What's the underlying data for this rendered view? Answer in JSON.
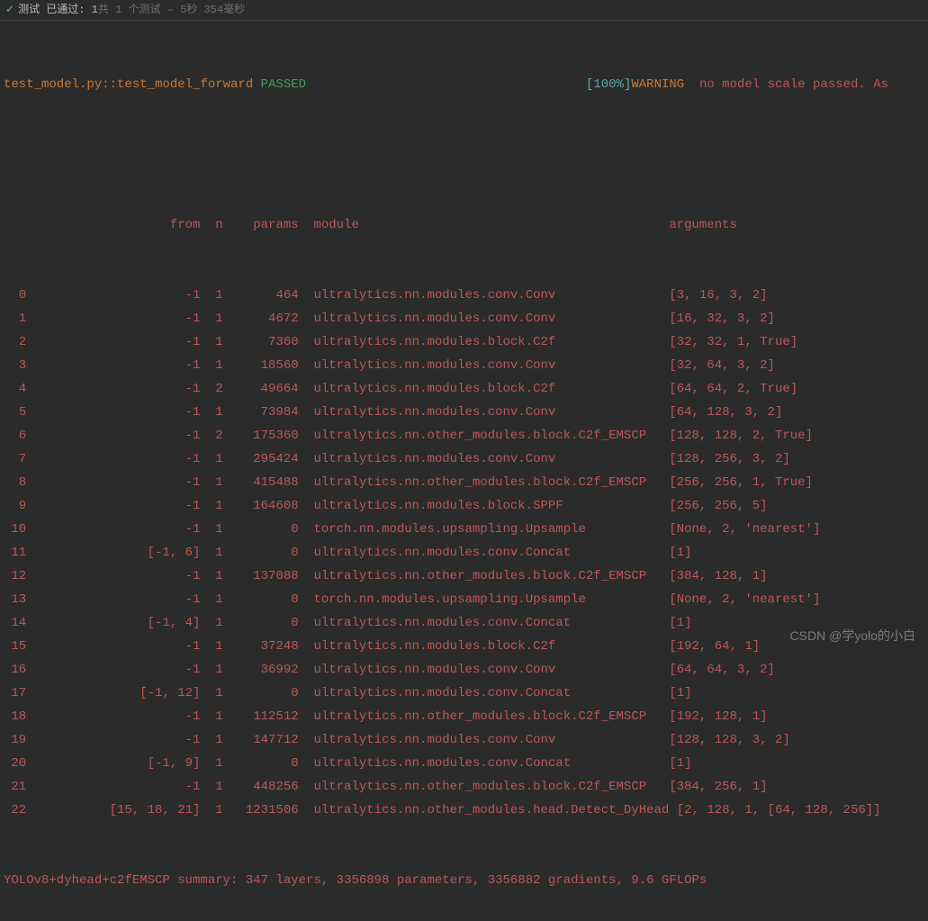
{
  "status": {
    "passed_label": "测试 已通过: 1",
    "detail": "共 1 个测试 – 5秒 354毫秒"
  },
  "header_line": {
    "test_path": "test_model.py::test_model_forward",
    "result": "PASSED",
    "progress": "[100%]",
    "warning_label": "WARNING",
    "warning_text": "  no model scale passed. As"
  },
  "columns": {
    "from": "from",
    "n": "n",
    "params": "params",
    "module": "module",
    "arguments": "arguments"
  },
  "rows": [
    {
      "idx": "0",
      "from": "-1",
      "n": "1",
      "params": "464",
      "module": "ultralytics.nn.modules.conv.Conv",
      "args": "[3, 16, 3, 2]"
    },
    {
      "idx": "1",
      "from": "-1",
      "n": "1",
      "params": "4672",
      "module": "ultralytics.nn.modules.conv.Conv",
      "args": "[16, 32, 3, 2]"
    },
    {
      "idx": "2",
      "from": "-1",
      "n": "1",
      "params": "7360",
      "module": "ultralytics.nn.modules.block.C2f",
      "args": "[32, 32, 1, True]"
    },
    {
      "idx": "3",
      "from": "-1",
      "n": "1",
      "params": "18560",
      "module": "ultralytics.nn.modules.conv.Conv",
      "args": "[32, 64, 3, 2]"
    },
    {
      "idx": "4",
      "from": "-1",
      "n": "2",
      "params": "49664",
      "module": "ultralytics.nn.modules.block.C2f",
      "args": "[64, 64, 2, True]"
    },
    {
      "idx": "5",
      "from": "-1",
      "n": "1",
      "params": "73984",
      "module": "ultralytics.nn.modules.conv.Conv",
      "args": "[64, 128, 3, 2]"
    },
    {
      "idx": "6",
      "from": "-1",
      "n": "2",
      "params": "175360",
      "module": "ultralytics.nn.other_modules.block.C2f_EMSCP",
      "args": "[128, 128, 2, True]"
    },
    {
      "idx": "7",
      "from": "-1",
      "n": "1",
      "params": "295424",
      "module": "ultralytics.nn.modules.conv.Conv",
      "args": "[128, 256, 3, 2]"
    },
    {
      "idx": "8",
      "from": "-1",
      "n": "1",
      "params": "415488",
      "module": "ultralytics.nn.other_modules.block.C2f_EMSCP",
      "args": "[256, 256, 1, True]"
    },
    {
      "idx": "9",
      "from": "-1",
      "n": "1",
      "params": "164608",
      "module": "ultralytics.nn.modules.block.SPPF",
      "args": "[256, 256, 5]"
    },
    {
      "idx": "10",
      "from": "-1",
      "n": "1",
      "params": "0",
      "module": "torch.nn.modules.upsampling.Upsample",
      "args": "[None, 2, 'nearest']"
    },
    {
      "idx": "11",
      "from": "[-1, 6]",
      "n": "1",
      "params": "0",
      "module": "ultralytics.nn.modules.conv.Concat",
      "args": "[1]"
    },
    {
      "idx": "12",
      "from": "-1",
      "n": "1",
      "params": "137088",
      "module": "ultralytics.nn.other_modules.block.C2f_EMSCP",
      "args": "[384, 128, 1]"
    },
    {
      "idx": "13",
      "from": "-1",
      "n": "1",
      "params": "0",
      "module": "torch.nn.modules.upsampling.Upsample",
      "args": "[None, 2, 'nearest']"
    },
    {
      "idx": "14",
      "from": "[-1, 4]",
      "n": "1",
      "params": "0",
      "module": "ultralytics.nn.modules.conv.Concat",
      "args": "[1]"
    },
    {
      "idx": "15",
      "from": "-1",
      "n": "1",
      "params": "37248",
      "module": "ultralytics.nn.modules.block.C2f",
      "args": "[192, 64, 1]"
    },
    {
      "idx": "16",
      "from": "-1",
      "n": "1",
      "params": "36992",
      "module": "ultralytics.nn.modules.conv.Conv",
      "args": "[64, 64, 3, 2]"
    },
    {
      "idx": "17",
      "from": "[-1, 12]",
      "n": "1",
      "params": "0",
      "module": "ultralytics.nn.modules.conv.Concat",
      "args": "[1]"
    },
    {
      "idx": "18",
      "from": "-1",
      "n": "1",
      "params": "112512",
      "module": "ultralytics.nn.other_modules.block.C2f_EMSCP",
      "args": "[192, 128, 1]"
    },
    {
      "idx": "19",
      "from": "-1",
      "n": "1",
      "params": "147712",
      "module": "ultralytics.nn.modules.conv.Conv",
      "args": "[128, 128, 3, 2]"
    },
    {
      "idx": "20",
      "from": "[-1, 9]",
      "n": "1",
      "params": "0",
      "module": "ultralytics.nn.modules.conv.Concat",
      "args": "[1]"
    },
    {
      "idx": "21",
      "from": "-1",
      "n": "1",
      "params": "448256",
      "module": "ultralytics.nn.other_modules.block.C2f_EMSCP",
      "args": "[384, 256, 1]"
    },
    {
      "idx": "22",
      "from": "[15, 18, 21]",
      "n": "1",
      "params": "1231506",
      "module": "ultralytics.nn.other_modules.head.Detect_DyHead",
      "args": "[2, 128, 1, [64, 128, 256]]"
    }
  ],
  "summary": "YOLOv8+dyhead+c2fEMSCP summary: 347 layers, 3356898 parameters, 3356882 gradients, 9.6 GFLOPs",
  "watermark": "CSDN @学yolo的小白"
}
